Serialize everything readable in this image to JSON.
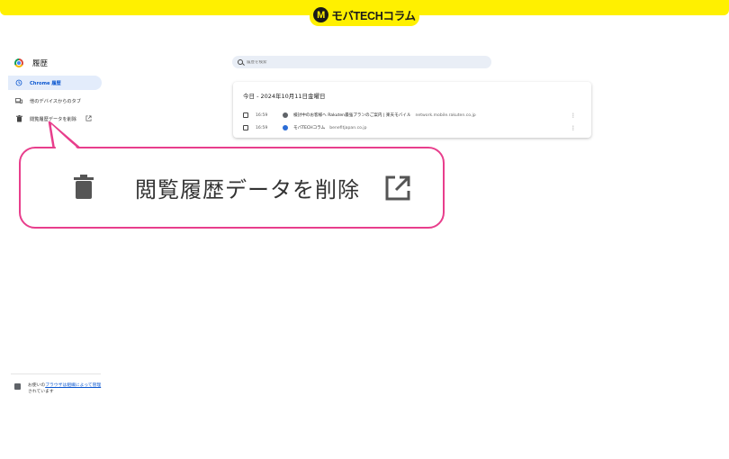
{
  "brand": {
    "logo_letter": "M",
    "name": "モバTECHコラム"
  },
  "sidebar": {
    "title": "履歴",
    "items": [
      {
        "label": "Chrome 履歴",
        "icon": "history-icon",
        "active": true
      },
      {
        "label": "他のデバイスからのタブ",
        "icon": "devices-icon",
        "active": false
      },
      {
        "label": "閲覧履歴データを削除",
        "icon": "trash-icon",
        "active": false,
        "external": true
      }
    ],
    "managed": {
      "prefix": "お使いの",
      "link": "ブラウザは組織によって管理",
      "suffix": "されています"
    }
  },
  "search": {
    "placeholder": "履歴を検索"
  },
  "history": {
    "date_heading": "今日 - 2024年10月11日金曜日",
    "rows": [
      {
        "time": "16:59",
        "title": "検討中のお客様へ Rakuten最強プランのご案内 | 楽天モバイル",
        "domain": "network.mobile.rakuten.co.jp",
        "favicon": "globe-icon"
      },
      {
        "time": "16:59",
        "title": "モバTECHコラム",
        "domain": "benefitjapan.co.jp",
        "favicon": "mobatech-icon"
      }
    ],
    "more_glyph": "⋮"
  },
  "callout": {
    "text": "閲覧履歴データを削除",
    "accent": "#e83e8c"
  },
  "colors": {
    "banner": "#fff000",
    "active_nav_bg": "#e3ecfb",
    "active_nav_text": "#0b57d0"
  }
}
